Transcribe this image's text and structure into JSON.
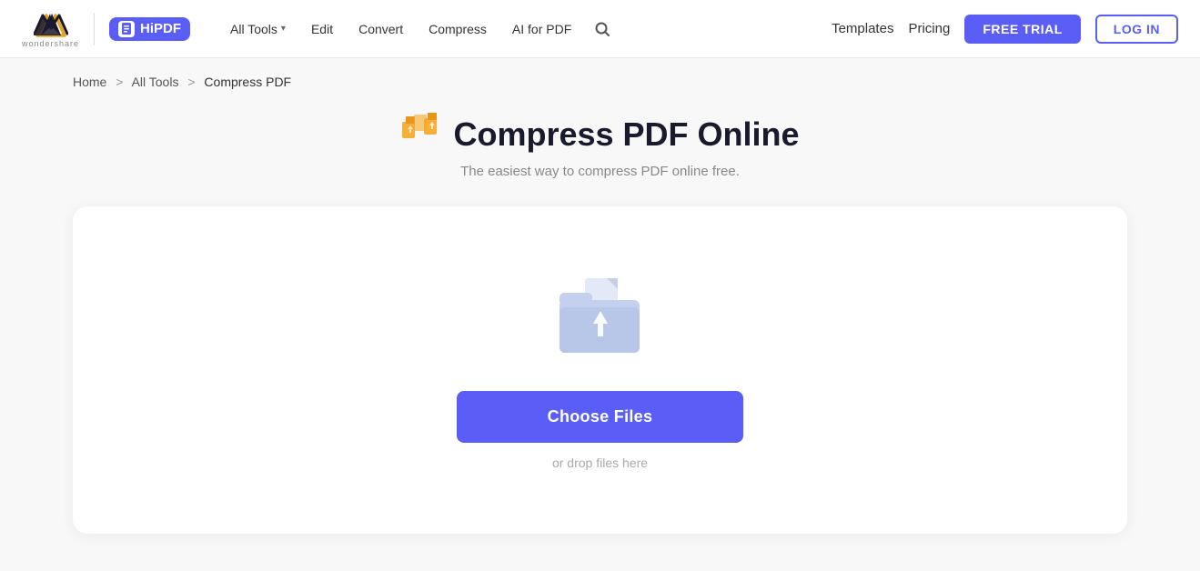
{
  "header": {
    "brand": {
      "company": "wondershare",
      "product": "HiPDF"
    },
    "nav": {
      "all_tools_label": "All Tools",
      "edit_label": "Edit",
      "convert_label": "Convert",
      "compress_label": "Compress",
      "ai_label": "AI for PDF"
    },
    "right_nav": {
      "templates_label": "Templates",
      "pricing_label": "Pricing",
      "free_trial_label": "FREE TRIAL",
      "login_label": "LOG IN"
    }
  },
  "breadcrumb": {
    "home": "Home",
    "all_tools": "All Tools",
    "current": "Compress PDF",
    "sep1": ">",
    "sep2": ">"
  },
  "main": {
    "title": "Compress PDF Online",
    "subtitle": "The easiest way to compress PDF online free.",
    "choose_files_label": "Choose Files",
    "drop_hint": "or drop files here"
  }
}
